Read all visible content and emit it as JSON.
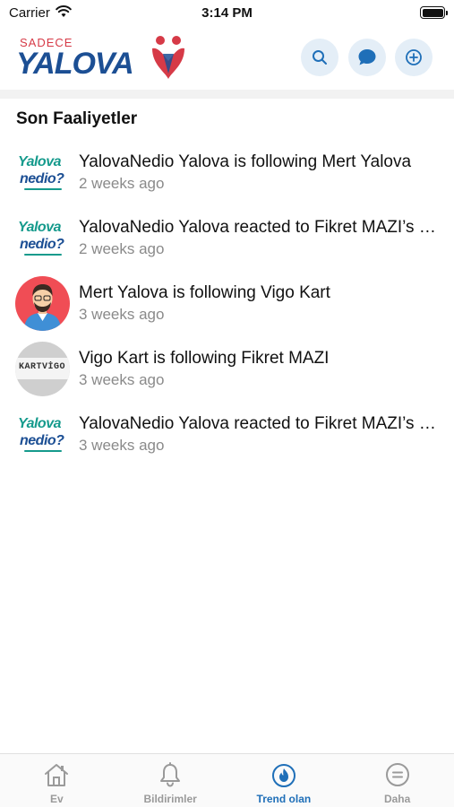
{
  "status_bar": {
    "carrier": "Carrier",
    "time": "3:14 PM",
    "wifi_icon": "wifi-icon",
    "battery_icon": "battery-icon"
  },
  "header": {
    "logo": {
      "small_text": "SADECE",
      "main_text": "YALOVA"
    },
    "actions": [
      {
        "icon": "search-icon",
        "color": "#1f6fb8"
      },
      {
        "icon": "chat-icon",
        "color": "#1f6fb8"
      },
      {
        "icon": "add-circle-icon",
        "color": "#1f6fb8"
      }
    ],
    "action_bg": "#e4eef7"
  },
  "section_title": "Son Faaliyetler",
  "activities": [
    {
      "avatar": "yalovanedio-logo",
      "text": "YalovaNedio Yalova is following Mert Yalova",
      "time": "2 weeks ago"
    },
    {
      "avatar": "yalovanedio-logo",
      "text": "YalovaNedio Yalova reacted to Fikret MAZI’s post",
      "time": "2 weeks ago"
    },
    {
      "avatar": "mert-avatar",
      "text": "Mert Yalova is following Vigo Kart",
      "time": "3 weeks ago"
    },
    {
      "avatar": "vigo-kart-logo",
      "text": "Vigo Kart is following Fikret MAZI",
      "time": "3 weeks ago"
    },
    {
      "avatar": "yalovanedio-logo",
      "text": "YalovaNedio Yalova reacted to Fikret MAZI’s post",
      "time": "3 weeks ago"
    }
  ],
  "avatar_text": {
    "yalova_top": "Yalova",
    "yalova_bottom": "nedio?",
    "vigo": "KARTVİGO"
  },
  "tabs": [
    {
      "label": "Ev",
      "icon": "home-icon",
      "active": false
    },
    {
      "label": "Bildirimler",
      "icon": "bell-icon",
      "active": false
    },
    {
      "label": "Trend olan",
      "icon": "flame-icon",
      "active": true
    },
    {
      "label": "Daha",
      "icon": "menu-circle-icon",
      "active": false
    }
  ],
  "colors": {
    "accent": "#1f6fb8",
    "brand_red": "#d63a47",
    "brand_blue": "#1c4f94",
    "inactive_tab": "#9a9a9a",
    "secondary_text": "#8a8a8a"
  }
}
